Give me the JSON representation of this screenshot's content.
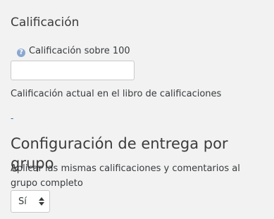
{
  "grade_section": {
    "title": "Calificación",
    "help_icon": "question-circle-icon",
    "grade_label": "Calificación sobre 100",
    "grade_input_value": "",
    "current_grade_text": "Calificación actual en el libro de calificaciones",
    "link_text": "-"
  },
  "group_section": {
    "title": "Configuración de entrega por grupo",
    "apply_label": "Aplicar las mismas calificaciones y comentarios al grupo completo",
    "select_value": "Sí"
  },
  "colors": {
    "background": "#f2f2f2",
    "text": "#373a3c",
    "link": "#0f6cbf",
    "help_icon": "#8aa8cf"
  }
}
